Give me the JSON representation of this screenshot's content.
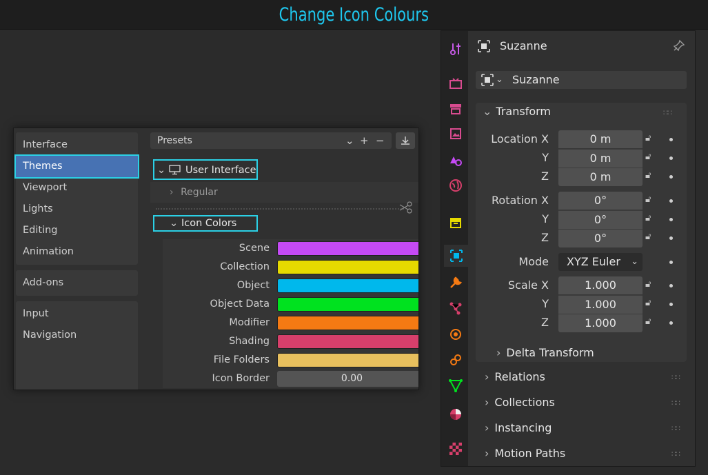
{
  "title": "Change Icon Colours",
  "prefs": {
    "nav_groups": [
      [
        "Interface",
        "Themes",
        "Viewport",
        "Lights",
        "Editing",
        "Animation"
      ],
      [
        "Add-ons"
      ],
      [
        "Input",
        "Navigation"
      ]
    ],
    "active_item": "Themes",
    "presets_label": "Presets",
    "user_interface_label": "User Interface",
    "regular_label": "Regular",
    "icon_colors_label": "Icon Colors",
    "icon_colors": [
      {
        "label": "Scene",
        "color": "#c54af5"
      },
      {
        "label": "Collection",
        "color": "#e6da00"
      },
      {
        "label": "Object",
        "color": "#00b8ec"
      },
      {
        "label": "Object Data",
        "color": "#00e21f"
      },
      {
        "label": "Modifier",
        "color": "#f57a13"
      },
      {
        "label": "Shading",
        "color": "#d73f6b"
      },
      {
        "label": "File Folders",
        "color": "#e8c05e"
      }
    ],
    "icon_border_label": "Icon Border",
    "icon_border_value": "0.00"
  },
  "props": {
    "object_name": "Suzanne",
    "selector_name": "Suzanne",
    "transform_label": "Transform",
    "location": {
      "label": "Location X",
      "y_label": "Y",
      "z_label": "Z",
      "values": [
        "0 m",
        "0 m",
        "0 m"
      ]
    },
    "rotation": {
      "label": "Rotation X",
      "y_label": "Y",
      "z_label": "Z",
      "values": [
        "0°",
        "0°",
        "0°"
      ]
    },
    "mode_label": "Mode",
    "mode_value": "XYZ Euler",
    "scale": {
      "label": "Scale X",
      "y_label": "Y",
      "z_label": "Z",
      "values": [
        "1.000",
        "1.000",
        "1.000"
      ]
    },
    "delta_transform_label": "Delta Transform",
    "sections": [
      "Relations",
      "Collections",
      "Instancing",
      "Motion Paths"
    ],
    "tab_icons": [
      "tool-icon",
      "render-icon",
      "output-icon",
      "view-layer-icon",
      "scene-icon",
      "world-icon",
      "collection-icon",
      "object-icon",
      "modifier-icon",
      "particles-icon",
      "physics-icon",
      "constraints-icon",
      "object-data-icon",
      "material-icon",
      "texture-icon"
    ]
  }
}
